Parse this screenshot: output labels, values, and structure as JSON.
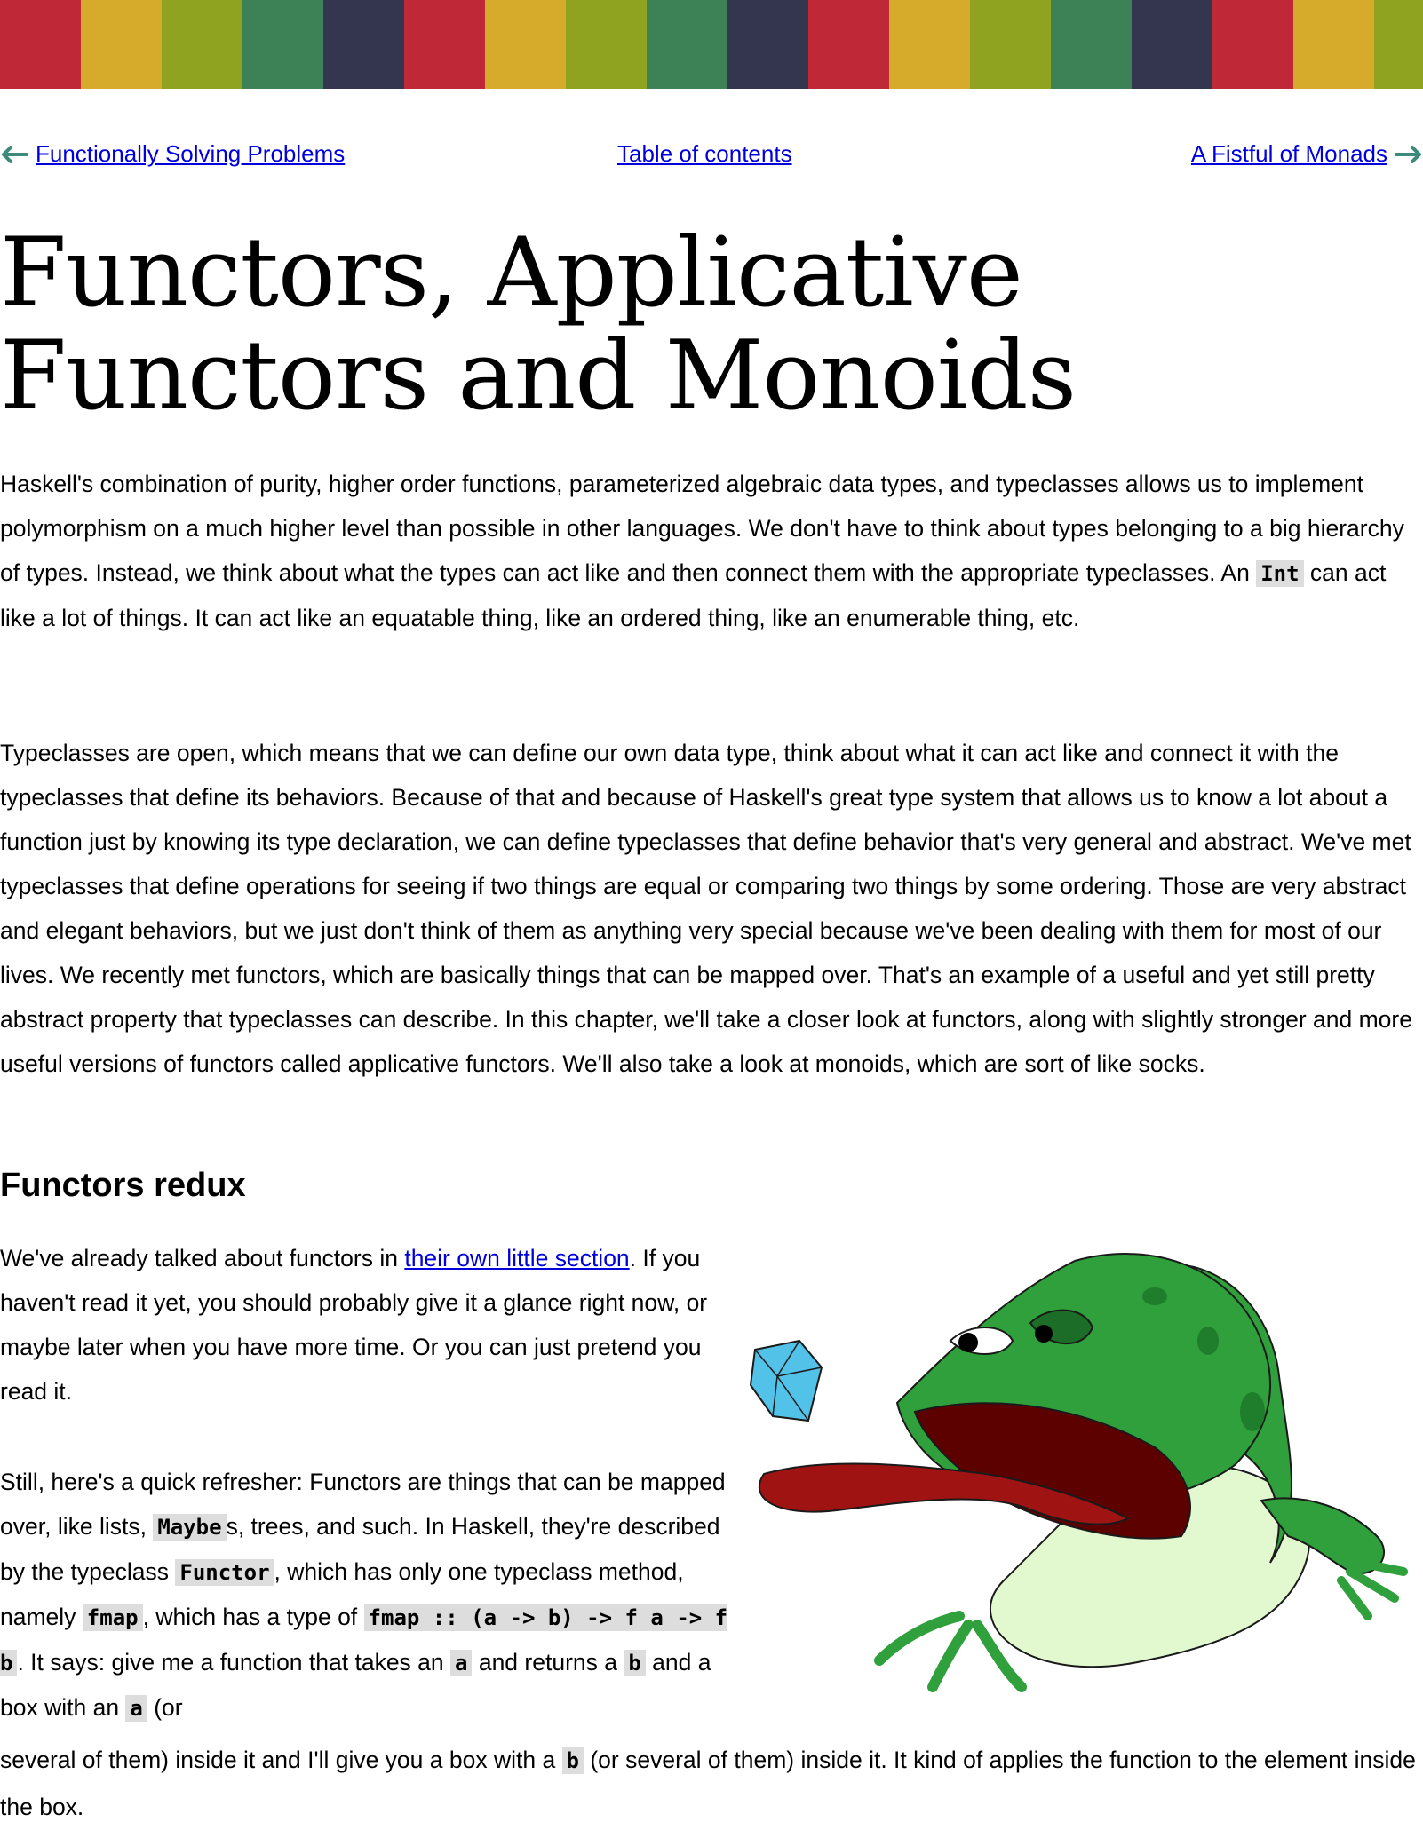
{
  "stripe_colors": [
    "#bf2836",
    "#d6ab2c",
    "#90a320",
    "#3d8256",
    "#33364e",
    "#bf2836",
    "#d6ab2c",
    "#90a320",
    "#3d8256",
    "#33364e",
    "#bf2836",
    "#d6ab2c",
    "#90a320",
    "#3d8256",
    "#33364e",
    "#bf2836",
    "#d6ab2c",
    "#90a320"
  ],
  "nav": {
    "prev_label": "Functionally Solving Problems",
    "toc_label": "Table of contents",
    "next_label": "A Fistful of Monads"
  },
  "title_line1": "Functors, Applicative",
  "title_line2": "Functors and Monoids",
  "intro": {
    "p1_a": "Haskell's combination of purity, higher order functions, parameterized algebraic data types, and typeclasses allows us to implement polymorphism on a much higher level than possible in other languages. We don't have to think about types belonging to a big hierarchy of types. Instead, we think about what the types can act like and then connect them with the appropriate typeclasses. An ",
    "p1_code": "Int",
    "p1_b": " can act like a lot of things. It can act like an equatable thing, like an ordered thing, like an enumerable thing, etc.",
    "p2": "Typeclasses are open, which means that we can define our own data type, think about what it can act like and connect it with the typeclasses that define its behaviors. Because of that and because of Haskell's great type system that allows us to know a lot about a function just by knowing its type declaration, we can define typeclasses that define behavior that's very general and abstract. We've met typeclasses that define operations for seeing if two things are equal or comparing two things by some ordering. Those are very abstract and elegant behaviors, but we just don't think of them as anything very special because we've been dealing with them for most of our lives. We recently met functors, which are basically things that can be mapped over. That's an example of a useful and yet still pretty abstract property that typeclasses can describe. In this chapter, we'll take a closer look at functors, along with slightly stronger and more useful versions of functors called applicative functors. We'll also take a look at monoids, which are sort of like socks."
  },
  "section": {
    "heading": "Functors redux",
    "p3_a": "We've already talked about functors in ",
    "p3_link": "their own little section",
    "p3_b": ". If you haven't read it yet, you should probably give it a glance right now, or maybe later when you have more time. Or you can just pretend you read it.",
    "p4_a": "Still, here's a quick refresher: Functors are things that can be mapped over, like lists, ",
    "p4_code1": "Maybe",
    "p4_b": "s, trees, and such. In Haskell, they're described by the typeclass ",
    "p4_code2": "Functor",
    "p4_c": ", which has only one typeclass method, namely ",
    "p4_code3": "fmap",
    "p4_d": ", which has a type of ",
    "p4_code4": "fmap :: (a -> b) -> f a -> f b",
    "p4_e": ". It says: give me a function that takes an ",
    "p4_code5": "a",
    "p4_f": " and returns a ",
    "p4_code6": "b",
    "p4_g": " and a box with an ",
    "p4_code7": "a",
    "p4_h": " (or",
    "p4_tail_a": "several of them) inside it and I'll give you a box with a ",
    "p4_code8": "b",
    "p4_tail_b": " (or several of them) inside it. It kind of applies the function to the element inside the box."
  }
}
